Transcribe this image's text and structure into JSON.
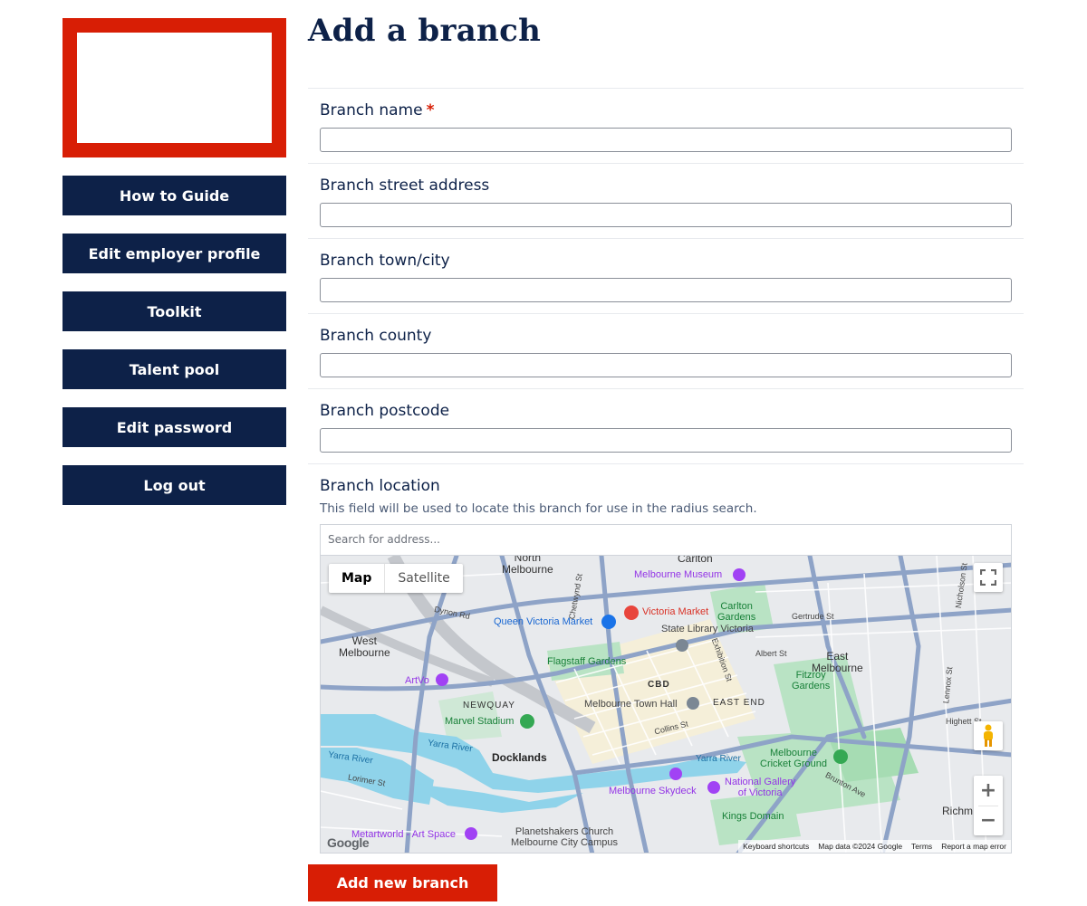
{
  "sidebar": {
    "nav": [
      {
        "label": "How to Guide"
      },
      {
        "label": "Edit employer profile"
      },
      {
        "label": "Toolkit"
      },
      {
        "label": "Talent pool"
      },
      {
        "label": "Edit password"
      },
      {
        "label": "Log out"
      }
    ]
  },
  "page": {
    "title": "Add a branch"
  },
  "form": {
    "fields": [
      {
        "label": "Branch name",
        "required_mark": "*"
      },
      {
        "label": "Branch street address"
      },
      {
        "label": "Branch town/city"
      },
      {
        "label": "Branch county"
      },
      {
        "label": "Branch postcode"
      }
    ],
    "location": {
      "label": "Branch location",
      "help": "This field will be used to locate this branch for use in the radius search.",
      "search_placeholder": "Search for address..."
    },
    "submit_label": "Add new branch"
  },
  "map": {
    "type_buttons": {
      "map": "Map",
      "satellite": "Satellite"
    },
    "zoom_in": "+",
    "zoom_out": "−",
    "logo": "Google",
    "footer": {
      "shortcuts": "Keyboard shortcuts",
      "data": "Map data ©2024 Google",
      "terms": "Terms",
      "report": "Report a map error"
    },
    "labels": {
      "north_melbourne": "North\nMelbourne",
      "carlton": "Carlton",
      "melbourne_museum": "Melbourne Museum",
      "victoria_market": "Victoria Market",
      "carlton_gardens": "Carlton\nGardens",
      "queen_victoria_market": "Queen Victoria Market",
      "state_library": "State Library Victoria",
      "gertrude_st": "Gertrude St",
      "dynon_rd": "Dynon Rd",
      "west_melbourne": "West\nMelbourne",
      "east_melbourne": "East\nMelbourne",
      "flagstaff_gardens": "Flagstaff Gardens",
      "albert_st": "Albert St",
      "fitzroy_gardens": "Fitzroy\nGardens",
      "artvo": "ArtVo",
      "cbd": "CBD",
      "newquay": "NEWQUAY",
      "melbourne_town_hall": "Melbourne Town Hall",
      "east_end": "EAST END",
      "marvel_stadium": "Marvel Stadium",
      "collins_st": "Collins St",
      "yarra_river_1": "Yarra River",
      "yarra_river_2": "Yarra River",
      "yarra_river_3": "Yarra River",
      "docklands": "Docklands",
      "lorimer_st": "Lorimer St",
      "melbourne_skydeck": "Melbourne Skydeck",
      "national_gallery": "National Gallery\nof Victoria",
      "mcg": "Melbourne\nCricket Ground",
      "brunton_ave": "Brunton Ave",
      "kings_domain": "Kings Domain",
      "richmond": "Richm",
      "metartworld": "Metartworld - Art Space",
      "planetshakers": "Planetshakers Church\nMelbourne City Campus",
      "nicholson_st": "Nicholson St",
      "highett_st": "Highett St",
      "lennox_st": "Lennox St",
      "exhibition_st": "Exhibition St",
      "chetwynd_st": "Chetwynd St"
    }
  }
}
